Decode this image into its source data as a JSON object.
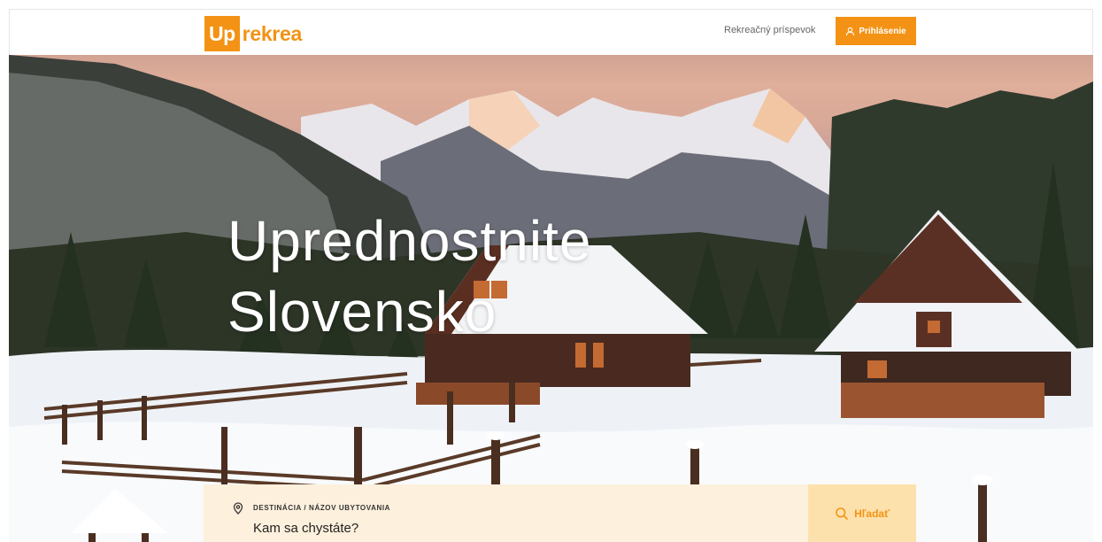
{
  "header": {
    "logo": {
      "highlight": "Up",
      "rest": "rekrea"
    },
    "nav_link": "Rekreačný príspevok",
    "login_label": "Prihlásenie"
  },
  "hero": {
    "title_line1": "Uprednostnite",
    "title_line2": "Slovensko"
  },
  "search": {
    "label": "DESTINÁCIA / NÁZOV UBYTOVANIA",
    "placeholder": "Kam sa chystáte?",
    "button_label": "Hľadať"
  },
  "colors": {
    "brand": "#f39214",
    "search_bg": "#fdf0dc",
    "search_button_bg": "#fde1ac"
  },
  "icons": [
    "user-icon",
    "map-pin-icon",
    "search-icon"
  ]
}
